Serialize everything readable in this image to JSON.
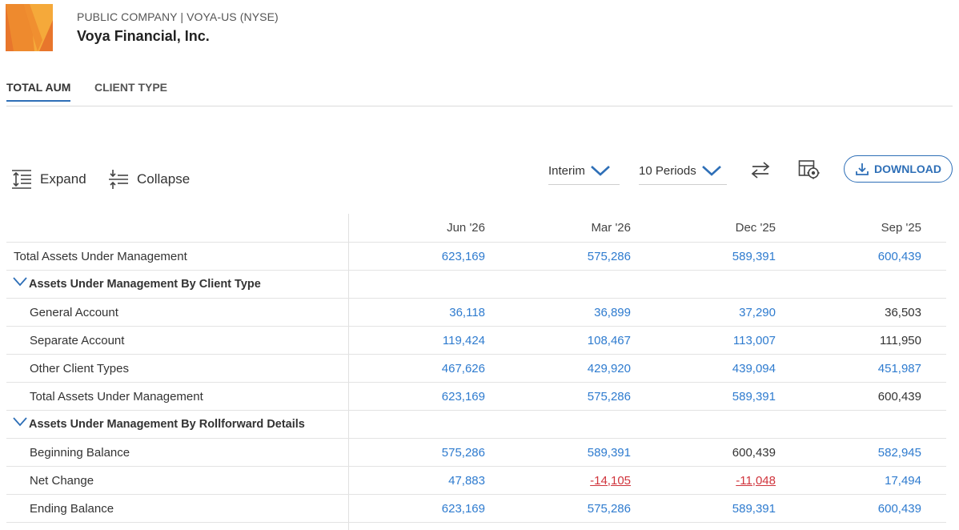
{
  "company": {
    "type_line": "PUBLIC COMPANY | VOYA-US (NYSE)",
    "name": "Voya Financial, Inc."
  },
  "tabs": [
    {
      "label": "TOTAL AUM",
      "active": true
    },
    {
      "label": "CLIENT TYPE",
      "active": false
    }
  ],
  "toolbar": {
    "expand_label": "Expand",
    "collapse_label": "Collapse",
    "period_type": "Interim",
    "period_count": "10 Periods",
    "download_label": "DOWNLOAD"
  },
  "colors": {
    "accent": "#2e6fb7",
    "link_value": "#2e7bcf",
    "negative": "#d0343c"
  },
  "table": {
    "columns": [
      "Jun '26",
      "Mar '26",
      "Dec '25",
      "Sep '25"
    ],
    "rows": [
      {
        "kind": "row",
        "label": "Total Assets Under Management",
        "indent": false,
        "values": [
          {
            "v": "623,169",
            "link": true
          },
          {
            "v": "575,286",
            "link": true
          },
          {
            "v": "589,391",
            "link": true
          },
          {
            "v": "600,439",
            "link": true
          }
        ]
      },
      {
        "kind": "section",
        "label": "Assets Under Management By Client Type"
      },
      {
        "kind": "row",
        "label": "General Account",
        "indent": true,
        "values": [
          {
            "v": "36,118",
            "link": true
          },
          {
            "v": "36,899",
            "link": true
          },
          {
            "v": "37,290",
            "link": true
          },
          {
            "v": "36,503",
            "link": false
          }
        ]
      },
      {
        "kind": "row",
        "label": "Separate Account",
        "indent": true,
        "values": [
          {
            "v": "119,424",
            "link": true
          },
          {
            "v": "108,467",
            "link": true
          },
          {
            "v": "113,007",
            "link": true
          },
          {
            "v": "111,950",
            "link": false
          }
        ]
      },
      {
        "kind": "row",
        "label": "Other Client Types",
        "indent": true,
        "values": [
          {
            "v": "467,626",
            "link": true
          },
          {
            "v": "429,920",
            "link": true
          },
          {
            "v": "439,094",
            "link": true
          },
          {
            "v": "451,987",
            "link": true
          }
        ]
      },
      {
        "kind": "row",
        "label": "Total Assets Under Management",
        "indent": true,
        "values": [
          {
            "v": "623,169",
            "link": true
          },
          {
            "v": "575,286",
            "link": true
          },
          {
            "v": "589,391",
            "link": true
          },
          {
            "v": "600,439",
            "link": false
          }
        ]
      },
      {
        "kind": "section",
        "label": "Assets Under Management By Rollforward Details"
      },
      {
        "kind": "row",
        "label": "Beginning Balance",
        "indent": true,
        "values": [
          {
            "v": "575,286",
            "link": true
          },
          {
            "v": "589,391",
            "link": true
          },
          {
            "v": "600,439",
            "link": false
          },
          {
            "v": "582,945",
            "link": true
          }
        ]
      },
      {
        "kind": "row",
        "label": "Net Change",
        "indent": true,
        "values": [
          {
            "v": "47,883",
            "link": true
          },
          {
            "v": "-14,105",
            "link": true,
            "negative": true
          },
          {
            "v": "-11,048",
            "link": true,
            "negative": true
          },
          {
            "v": "17,494",
            "link": true
          }
        ]
      },
      {
        "kind": "row",
        "label": "Ending Balance",
        "indent": true,
        "values": [
          {
            "v": "623,169",
            "link": true
          },
          {
            "v": "575,286",
            "link": true
          },
          {
            "v": "589,391",
            "link": true
          },
          {
            "v": "600,439",
            "link": true
          }
        ]
      }
    ]
  }
}
